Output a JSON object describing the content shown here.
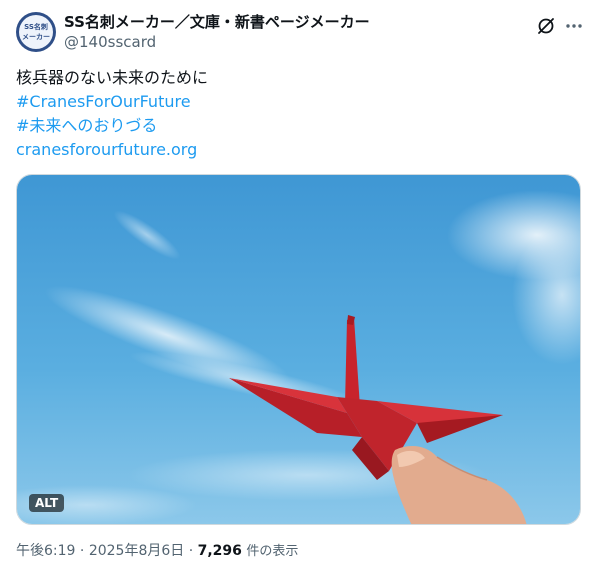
{
  "author": {
    "display_name": "SS名刺メーカー／文庫・新書ページメーカー",
    "handle": "@140sscard",
    "avatar_lines": [
      "SS名刺",
      "メーカー"
    ]
  },
  "tweet": {
    "text_line": "核兵器のない未来のために",
    "hashtag_1": "#CranesForOurFuture",
    "hashtag_2": "#未来へのおりづる",
    "link": "cranesforourfuture.org"
  },
  "media": {
    "alt_label": "ALT",
    "description_icon": "origami-crane-photo"
  },
  "footer": {
    "time": "午後6:19",
    "separator": "·",
    "date": "2025年8月6日",
    "views_count": "7,296",
    "views_label": "件の表示"
  },
  "icons": {
    "grok": "grok-icon",
    "more": "more-icon"
  },
  "colors": {
    "link": "#1d9bf0",
    "secondary_text": "#536471",
    "crane": "#c8232c",
    "sky": "#4fa3d9"
  }
}
